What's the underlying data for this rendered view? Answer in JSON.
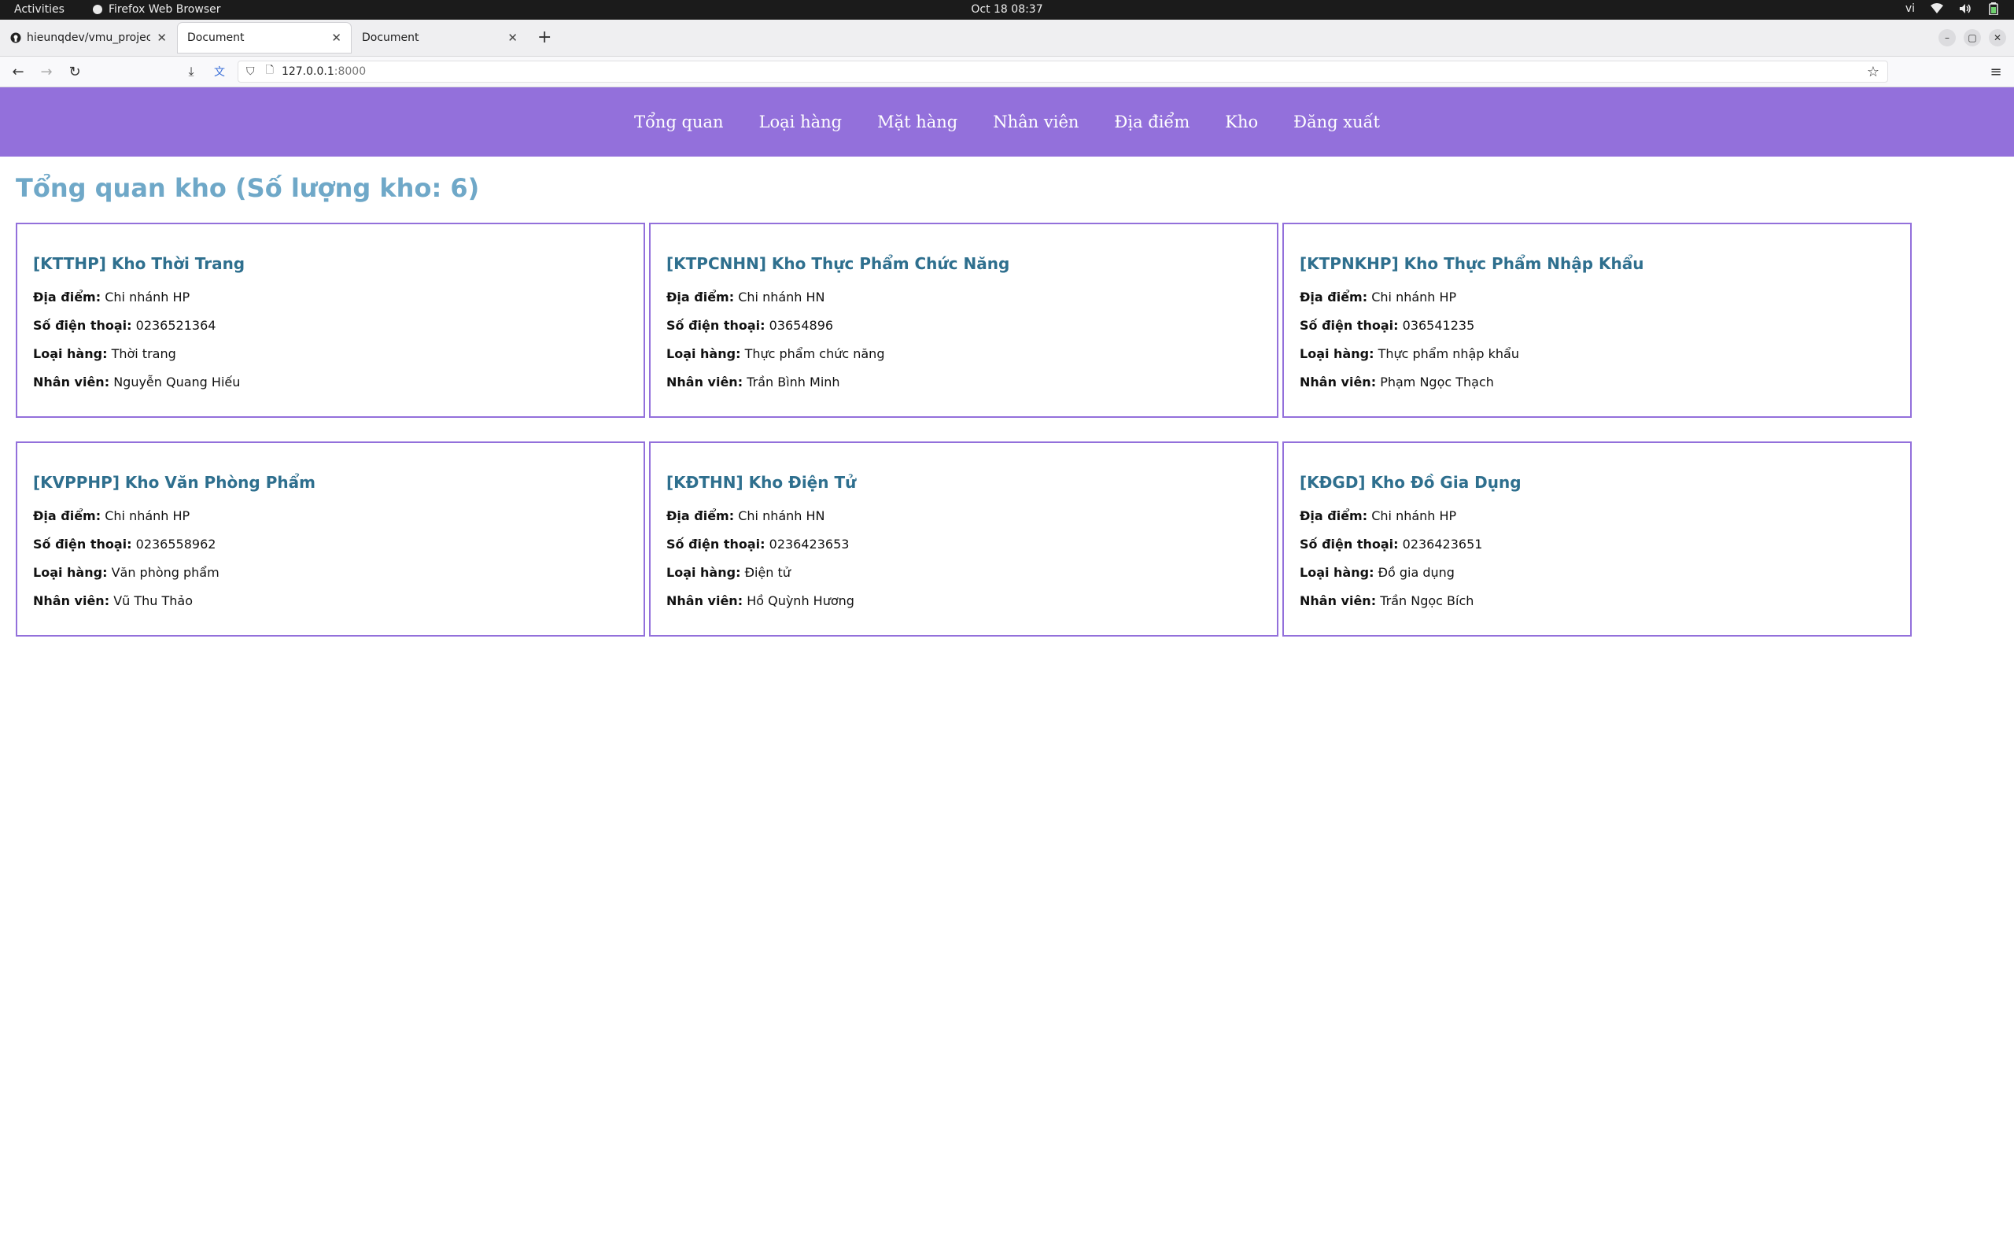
{
  "system": {
    "activities": "Activities",
    "app_name": "Firefox Web Browser",
    "clock": "Oct 18  08:37",
    "lang": "vi"
  },
  "browser": {
    "tabs": [
      {
        "title": "hieunqdev/vmu_project",
        "icon": "github-icon"
      },
      {
        "title": "Document",
        "icon": "none"
      },
      {
        "title": "Document",
        "icon": "none"
      }
    ],
    "url_host": "127.0.0.1",
    "url_port": ":8000"
  },
  "nav": {
    "items": [
      "Tổng quan",
      "Loại hàng",
      "Mặt hàng",
      "Nhân viên",
      "Địa điểm",
      "Kho",
      "Đăng xuất"
    ]
  },
  "page": {
    "title": "Tổng quan kho (Số lượng kho: 6)"
  },
  "labels": {
    "location": "Địa điểm:",
    "phone": "Số điện thoại:",
    "category": "Loại hàng:",
    "staff": "Nhân viên:"
  },
  "warehouses": [
    {
      "title": "[KTTHP] Kho Thời Trang",
      "location": "Chi nhánh HP",
      "phone": "0236521364",
      "category": "Thời trang",
      "staff": "Nguyễn Quang Hiếu"
    },
    {
      "title": "[KTPCNHN] Kho Thực Phẩm Chức Năng",
      "location": "Chi nhánh HN",
      "phone": "03654896",
      "category": "Thực phẩm chức năng",
      "staff": "Trần Bình Minh"
    },
    {
      "title": "[KTPNKHP] Kho Thực Phẩm Nhập Khẩu",
      "location": "Chi nhánh HP",
      "phone": "036541235",
      "category": "Thực phẩm nhập khẩu",
      "staff": "Phạm Ngọc Thạch"
    },
    {
      "title": "[KVPPHP] Kho Văn Phòng Phẩm",
      "location": "Chi nhánh HP",
      "phone": "0236558962",
      "category": "Văn phòng phẩm",
      "staff": "Vũ Thu Thảo"
    },
    {
      "title": "[KĐTHN] Kho Điện Tử",
      "location": "Chi nhánh HN",
      "phone": "0236423653",
      "category": "Điện tử",
      "staff": "Hồ Quỳnh Hương"
    },
    {
      "title": "[KĐGD] Kho Đồ Gia Dụng",
      "location": "Chi nhánh HP",
      "phone": "0236423651",
      "category": "Đồ gia dụng",
      "staff": "Trần Ngọc Bích"
    }
  ],
  "colors": {
    "nav_bg": "#9370db",
    "title": "#6fa8c8",
    "card_title": "#2e6f8e",
    "card_border": "#9370db"
  }
}
